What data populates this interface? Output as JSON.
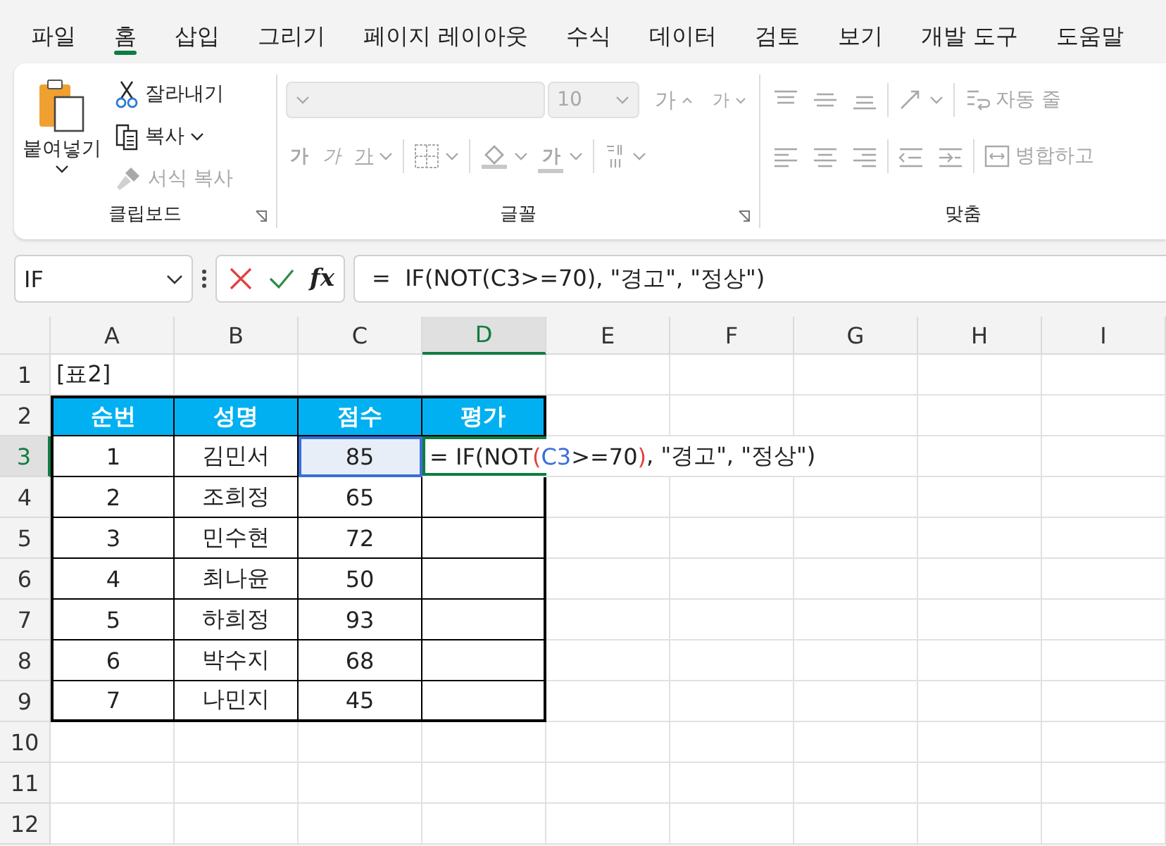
{
  "menu_tabs": [
    {
      "label": "파일",
      "selected": false
    },
    {
      "label": "홈",
      "selected": true
    },
    {
      "label": "삽입",
      "selected": false
    },
    {
      "label": "그리기",
      "selected": false
    },
    {
      "label": "페이지 레이아웃",
      "selected": false
    },
    {
      "label": "수식",
      "selected": false
    },
    {
      "label": "데이터",
      "selected": false
    },
    {
      "label": "검토",
      "selected": false
    },
    {
      "label": "보기",
      "selected": false
    },
    {
      "label": "개발 도구",
      "selected": false
    },
    {
      "label": "도움말",
      "selected": false
    }
  ],
  "ribbon": {
    "clipboard": {
      "label": "클립보드",
      "paste": {
        "label": "붙여넣기",
        "disabled": false
      },
      "cut": {
        "label": "잘라내기",
        "disabled": false
      },
      "copy": {
        "label": "복사",
        "disabled": false
      },
      "format_painter": {
        "label": "서식 복사",
        "disabled": true
      }
    },
    "font": {
      "label": "글꼴",
      "disabled": true,
      "font_size": "10",
      "grow": "가",
      "shrink": "가",
      "bold": "가",
      "italic": "가",
      "underline": "가",
      "font_color": "가"
    },
    "alignment": {
      "label": "맞춤",
      "disabled": true,
      "wrap_text": "자동 줄",
      "merge": "병합하고"
    }
  },
  "name_box": {
    "value": "IF"
  },
  "formula_bar": {
    "function_label": "fx",
    "value": "=  IF(NOT(C3>=70), \"경고\", \"정상\")"
  },
  "sheet": {
    "columns": [
      {
        "label": "A",
        "selected": false
      },
      {
        "label": "B",
        "selected": false
      },
      {
        "label": "C",
        "selected": false
      },
      {
        "label": "D",
        "selected": true
      },
      {
        "label": "E",
        "selected": false
      },
      {
        "label": "F",
        "selected": false
      },
      {
        "label": "G",
        "selected": false
      },
      {
        "label": "H",
        "selected": false
      },
      {
        "label": "I",
        "selected": false
      }
    ],
    "rows": [
      {
        "label": "1",
        "selected": false
      },
      {
        "label": "2",
        "selected": false
      },
      {
        "label": "3",
        "selected": true
      },
      {
        "label": "4",
        "selected": false
      },
      {
        "label": "5",
        "selected": false
      },
      {
        "label": "6",
        "selected": false
      },
      {
        "label": "7",
        "selected": false
      },
      {
        "label": "8",
        "selected": false
      },
      {
        "label": "9",
        "selected": false
      },
      {
        "label": "10",
        "selected": false
      },
      {
        "label": "11",
        "selected": false
      },
      {
        "label": "12",
        "selected": false
      }
    ],
    "table": {
      "title": "[표2]",
      "columns": [
        "순번",
        "성명",
        "점수",
        "평가"
      ],
      "rows": [
        {
          "cells": [
            {
              "text": "1",
              "referenced": false
            },
            {
              "text": "김민서",
              "referenced": false
            },
            {
              "text": "85",
              "referenced": true
            }
          ],
          "editing": [
            {
              "text": "= IF(NOT"
            },
            {
              "text": "(",
              "color": "#e0443a"
            },
            {
              "text": "C3",
              "color": "#3a6fd8"
            },
            {
              "text": ">=70"
            },
            {
              "text": ")",
              "color": "#e0443a"
            },
            {
              "text": ", \"경고\", \"정상\")"
            }
          ]
        },
        {
          "cells": [
            {
              "text": "2",
              "referenced": false
            },
            {
              "text": "조희정",
              "referenced": false
            },
            {
              "text": "65",
              "referenced": false
            }
          ]
        },
        {
          "cells": [
            {
              "text": "3",
              "referenced": false
            },
            {
              "text": "민수현",
              "referenced": false
            },
            {
              "text": "72",
              "referenced": false
            }
          ]
        },
        {
          "cells": [
            {
              "text": "4",
              "referenced": false
            },
            {
              "text": "최나윤",
              "referenced": false
            },
            {
              "text": "50",
              "referenced": false
            }
          ]
        },
        {
          "cells": [
            {
              "text": "5",
              "referenced": false
            },
            {
              "text": "하희정",
              "referenced": false
            },
            {
              "text": "93",
              "referenced": false
            }
          ]
        },
        {
          "cells": [
            {
              "text": "6",
              "referenced": false
            },
            {
              "text": "박수지",
              "referenced": false
            },
            {
              "text": "68",
              "referenced": false
            }
          ]
        },
        {
          "cells": [
            {
              "text": "7",
              "referenced": false
            },
            {
              "text": "나민지",
              "referenced": false
            },
            {
              "text": "45",
              "referenced": false
            }
          ]
        }
      ]
    }
  }
}
